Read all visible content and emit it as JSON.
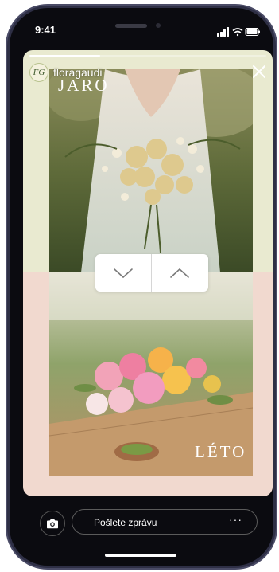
{
  "status_bar": {
    "time": "9:41"
  },
  "story": {
    "username": "floragaudi",
    "avatar_initials": "FG",
    "progress": 0.3,
    "top_title": "JARO",
    "bottom_title": "LÉTO"
  },
  "compare_controls": {
    "down_icon": "chevron-down-icon",
    "up_icon": "chevron-up-icon"
  },
  "composer": {
    "placeholder": "Pošlete zprávu",
    "more": "···"
  },
  "colors": {
    "top_bg": "#e9ead0",
    "bottom_bg": "#f1d9cf",
    "frame": "#0b0b10"
  }
}
